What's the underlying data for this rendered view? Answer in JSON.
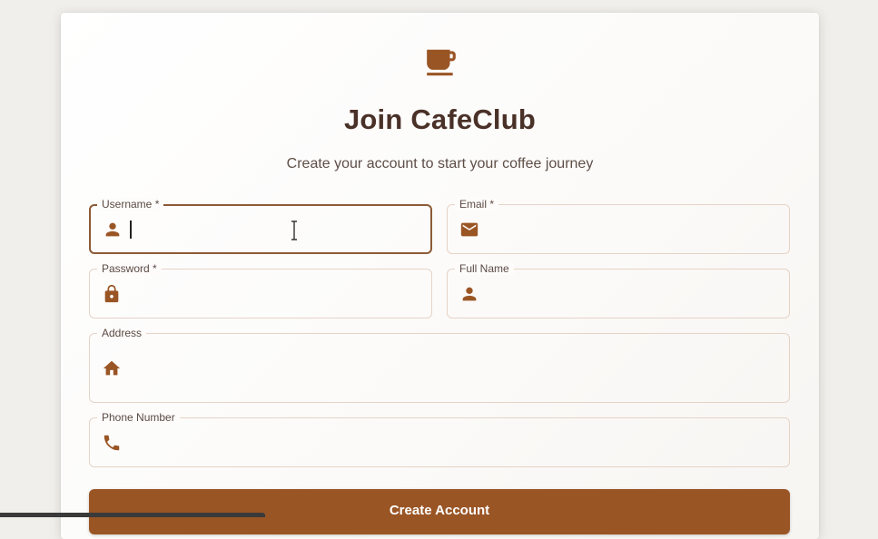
{
  "app": {
    "title": "Join CafeClub",
    "subtitle": "Create your account to start your coffee journey",
    "logo_icon": "coffee-cup-icon"
  },
  "form": {
    "username": {
      "label": "Username *",
      "value": "",
      "icon": "person-icon",
      "focused": true
    },
    "email": {
      "label": "Email *",
      "value": "",
      "icon": "mail-icon"
    },
    "password": {
      "label": "Password *",
      "value": "",
      "icon": "lock-icon"
    },
    "full_name": {
      "label": "Full Name",
      "value": "",
      "icon": "person-icon"
    },
    "address": {
      "label": "Address",
      "value": "",
      "icon": "home-icon"
    },
    "phone": {
      "label": "Phone Number",
      "value": "",
      "icon": "phone-icon"
    },
    "submit_label": "Create Account"
  },
  "theme": {
    "accent": "#9a5525",
    "title_color": "#4a3128",
    "field_border": "#e6d3c6",
    "focus_border": "#8d5a36"
  }
}
